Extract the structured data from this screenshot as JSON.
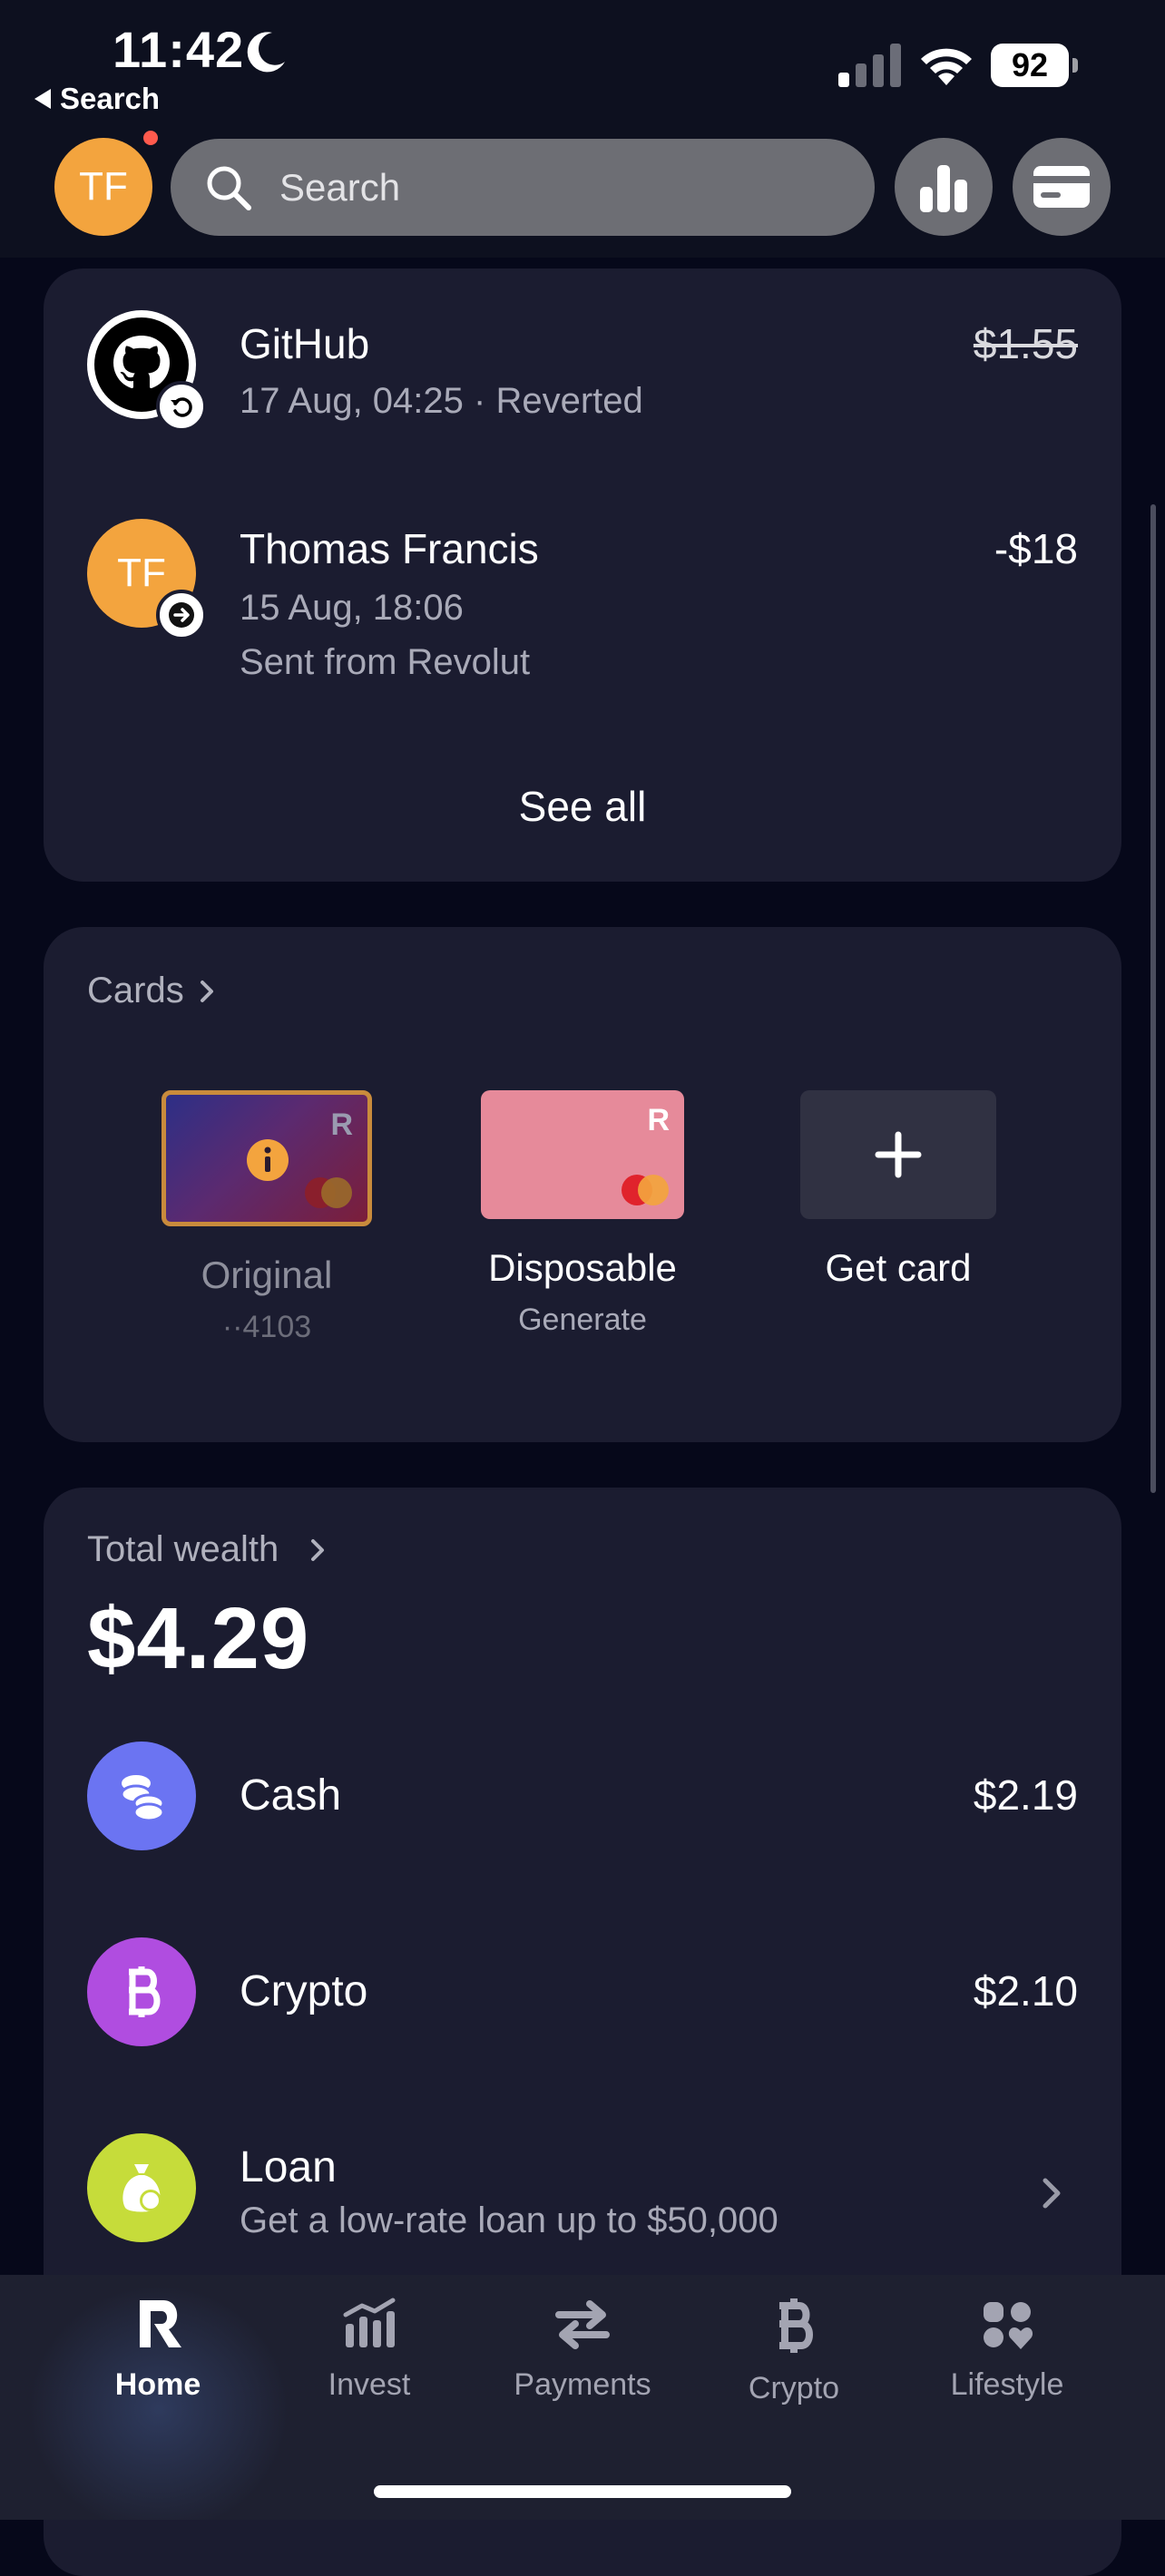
{
  "status_bar": {
    "time": "11:42",
    "battery": "92",
    "back_label": "Search"
  },
  "header": {
    "avatar_initials": "TF",
    "search_placeholder": "Search"
  },
  "transactions": {
    "items": [
      {
        "name": "GitHub",
        "subtitle": "17 Aug, 04:25 · Reverted",
        "amount": "$1.55",
        "icon": "github-icon",
        "badge": "revert-icon"
      },
      {
        "name": "Thomas Francis",
        "subtitle": "15 Aug, 18:06",
        "subtitle2": "Sent from Revolut",
        "amount": "-$18",
        "icon_initials": "TF",
        "badge": "arrow-right-icon"
      }
    ],
    "see_all": "See all"
  },
  "cards": {
    "title": "Cards",
    "items": [
      {
        "label": "Original",
        "sub": "··4103",
        "logo": "R"
      },
      {
        "label": "Disposable",
        "sub": "Generate",
        "logo": "R"
      },
      {
        "label": "Get card",
        "sub": ""
      }
    ]
  },
  "wealth": {
    "title": "Total wealth",
    "total": "$4.29",
    "items": [
      {
        "name": "Cash",
        "value": "$2.19",
        "icon": "coins-icon",
        "color": "#6b74f2"
      },
      {
        "name": "Crypto",
        "value": "$2.10",
        "icon": "bitcoin-icon",
        "color": "#b04de0"
      },
      {
        "name": "Loan",
        "sub": "Get a low-rate loan up to $50,000",
        "icon": "money-bag-icon",
        "color": "#c6dc3a"
      }
    ]
  },
  "tabbar": {
    "items": [
      {
        "label": "Home",
        "icon": "revolut-r-icon",
        "active": true
      },
      {
        "label": "Invest",
        "icon": "invest-chart-icon"
      },
      {
        "label": "Payments",
        "icon": "transfer-arrows-icon"
      },
      {
        "label": "Crypto",
        "icon": "bitcoin-icon"
      },
      {
        "label": "Lifestyle",
        "icon": "lifestyle-icon"
      }
    ]
  }
}
